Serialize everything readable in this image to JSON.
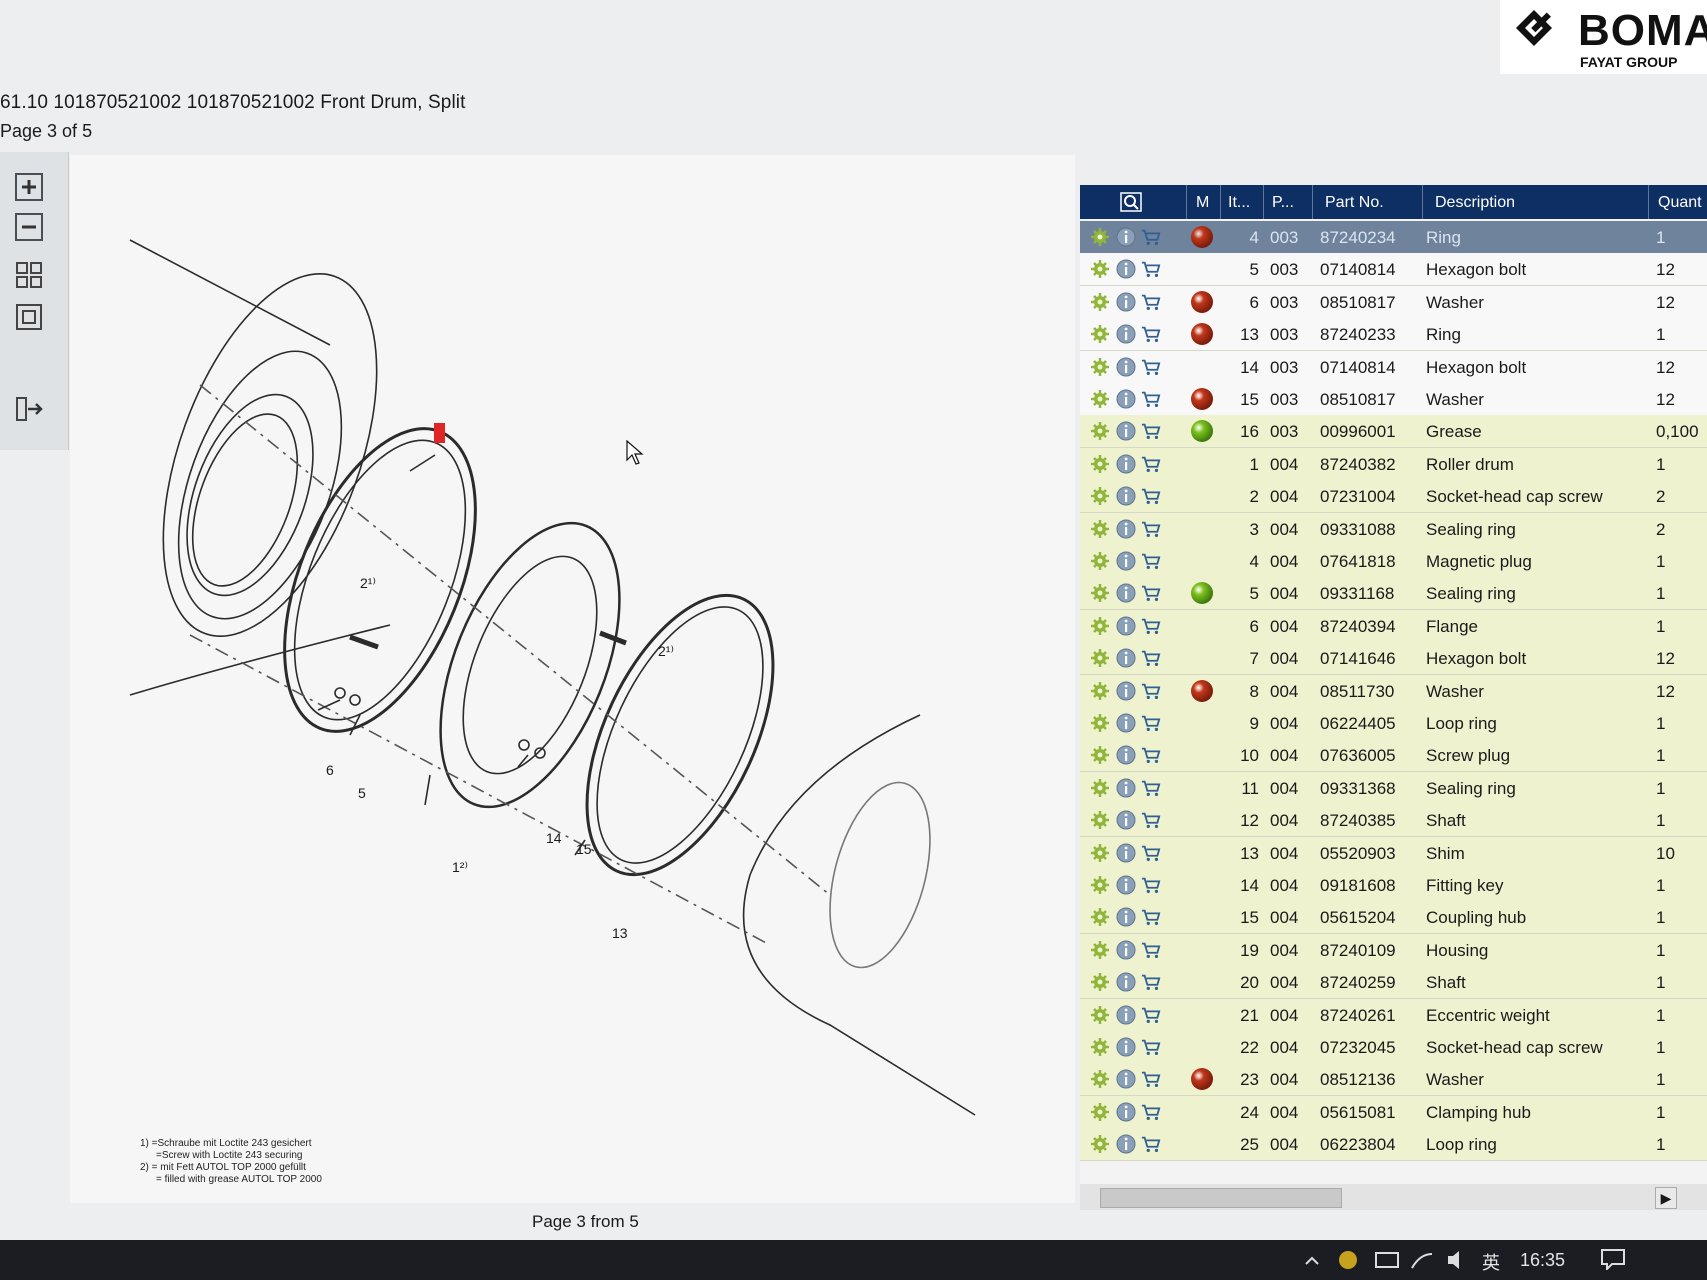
{
  "header": {
    "title": "61.10 101870521002 101870521002 Front Drum, Split",
    "page_label": "Page 3 of 5"
  },
  "logo": {
    "name": "BOMA",
    "group": "FAYAT GROUP"
  },
  "toolbar": {
    "items": [
      "zoom-in-icon",
      "zoom-out-icon",
      "fit-page-icon",
      "fit-width-icon",
      "toggle-panel-icon"
    ]
  },
  "drawing": {
    "callouts": [
      "2¹⁾",
      "2¹⁾",
      "6",
      "5",
      "1²⁾",
      "14",
      "15",
      "13"
    ],
    "footnotes": [
      "1) =Schraube mit Loctite 243 gesichert",
      "=Screw with Loctite 243 securing",
      "2) = mit Fett AUTOL TOP 2000 gefüllt",
      "= filled with grease AUTOL TOP 2000"
    ],
    "page_footer": "Page 3 from 5"
  },
  "parts_table": {
    "headers": {
      "m": "M",
      "item": "It...",
      "page": "P...",
      "part_no": "Part No.",
      "description": "Description",
      "quantity": "Quant"
    },
    "colors": {
      "header": "#0d2f63",
      "selected": "#6f839c",
      "green_row": "#eef2cf",
      "dot_red": "#c2371b",
      "dot_green": "#7ec21f"
    },
    "rows": [
      {
        "item": "4",
        "page": "003",
        "part_no": "87240234",
        "description": "Ring",
        "qty": "1",
        "dot": "red",
        "style": "sel"
      },
      {
        "item": "5",
        "page": "003",
        "part_no": "07140814",
        "description": "Hexagon bolt",
        "qty": "12",
        "dot": "",
        "style": "white"
      },
      {
        "item": "6",
        "page": "003",
        "part_no": "08510817",
        "description": "Washer",
        "qty": "12",
        "dot": "red",
        "style": "white"
      },
      {
        "item": "13",
        "page": "003",
        "part_no": "87240233",
        "description": "Ring",
        "qty": "1",
        "dot": "red",
        "style": "white"
      },
      {
        "item": "14",
        "page": "003",
        "part_no": "07140814",
        "description": "Hexagon bolt",
        "qty": "12",
        "dot": "",
        "style": "white"
      },
      {
        "item": "15",
        "page": "003",
        "part_no": "08510817",
        "description": "Washer",
        "qty": "12",
        "dot": "red",
        "style": "white"
      },
      {
        "item": "16",
        "page": "003",
        "part_no": "00996001",
        "description": "Grease",
        "qty": "0,100",
        "dot": "green",
        "style": "green"
      },
      {
        "item": "1",
        "page": "004",
        "part_no": "87240382",
        "description": "Roller drum",
        "qty": "1",
        "dot": "",
        "style": "green"
      },
      {
        "item": "2",
        "page": "004",
        "part_no": "07231004",
        "description": "Socket-head cap screw",
        "qty": "2",
        "dot": "",
        "style": "green"
      },
      {
        "item": "3",
        "page": "004",
        "part_no": "09331088",
        "description": "Sealing ring",
        "qty": "2",
        "dot": "",
        "style": "green"
      },
      {
        "item": "4",
        "page": "004",
        "part_no": "07641818",
        "description": "Magnetic plug",
        "qty": "1",
        "dot": "",
        "style": "green"
      },
      {
        "item": "5",
        "page": "004",
        "part_no": "09331168",
        "description": "Sealing ring",
        "qty": "1",
        "dot": "green",
        "style": "green"
      },
      {
        "item": "6",
        "page": "004",
        "part_no": "87240394",
        "description": "Flange",
        "qty": "1",
        "dot": "",
        "style": "green"
      },
      {
        "item": "7",
        "page": "004",
        "part_no": "07141646",
        "description": "Hexagon bolt",
        "qty": "12",
        "dot": "",
        "style": "green"
      },
      {
        "item": "8",
        "page": "004",
        "part_no": "08511730",
        "description": "Washer",
        "qty": "12",
        "dot": "red",
        "style": "green"
      },
      {
        "item": "9",
        "page": "004",
        "part_no": "06224405",
        "description": "Loop ring",
        "qty": "1",
        "dot": "",
        "style": "green"
      },
      {
        "item": "10",
        "page": "004",
        "part_no": "07636005",
        "description": "Screw plug",
        "qty": "1",
        "dot": "",
        "style": "green"
      },
      {
        "item": "11",
        "page": "004",
        "part_no": "09331368",
        "description": "Sealing ring",
        "qty": "1",
        "dot": "",
        "style": "green"
      },
      {
        "item": "12",
        "page": "004",
        "part_no": "87240385",
        "description": "Shaft",
        "qty": "1",
        "dot": "",
        "style": "green"
      },
      {
        "item": "13",
        "page": "004",
        "part_no": "05520903",
        "description": "Shim",
        "qty": "10",
        "dot": "",
        "style": "green"
      },
      {
        "item": "14",
        "page": "004",
        "part_no": "09181608",
        "description": "Fitting key",
        "qty": "1",
        "dot": "",
        "style": "green"
      },
      {
        "item": "15",
        "page": "004",
        "part_no": "05615204",
        "description": "Coupling hub",
        "qty": "1",
        "dot": "",
        "style": "green"
      },
      {
        "item": "19",
        "page": "004",
        "part_no": "87240109",
        "description": "Housing",
        "qty": "1",
        "dot": "",
        "style": "green"
      },
      {
        "item": "20",
        "page": "004",
        "part_no": "87240259",
        "description": "Shaft",
        "qty": "1",
        "dot": "",
        "style": "green"
      },
      {
        "item": "21",
        "page": "004",
        "part_no": "87240261",
        "description": "Eccentric weight",
        "qty": "1",
        "dot": "",
        "style": "green"
      },
      {
        "item": "22",
        "page": "004",
        "part_no": "07232045",
        "description": "Socket-head cap screw",
        "qty": "1",
        "dot": "",
        "style": "green"
      },
      {
        "item": "23",
        "page": "004",
        "part_no": "08512136",
        "description": "Washer",
        "qty": "1",
        "dot": "red",
        "style": "green"
      },
      {
        "item": "24",
        "page": "004",
        "part_no": "05615081",
        "description": "Clamping hub",
        "qty": "1",
        "dot": "",
        "style": "green"
      },
      {
        "item": "25",
        "page": "004",
        "part_no": "06223804",
        "description": "Loop ring",
        "qty": "1",
        "dot": "",
        "style": "green"
      }
    ]
  },
  "taskbar": {
    "ime": "英",
    "time": "16:35"
  }
}
